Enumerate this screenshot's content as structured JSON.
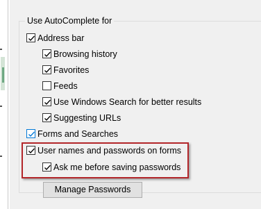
{
  "group": {
    "title": "Use AutoComplete for"
  },
  "options": [
    {
      "label": "Address bar",
      "checked": true
    },
    {
      "label": "Browsing history",
      "checked": true
    },
    {
      "label": "Favorites",
      "checked": true
    },
    {
      "label": "Feeds",
      "checked": false
    },
    {
      "label": "Use Windows Search for better results",
      "checked": true
    },
    {
      "label": "Suggesting URLs",
      "checked": true
    },
    {
      "label": "Forms and Searches",
      "checked": true
    },
    {
      "label": "User names and passwords on forms",
      "checked": true
    },
    {
      "label": "Ask me before saving passwords",
      "checked": true
    }
  ],
  "buttons": {
    "manage_passwords": "Manage Passwords"
  },
  "colors": {
    "highlight_border": "#b3262a",
    "hover_checkbox_border": "#0078d7",
    "dialog_background": "#f0f0f0"
  }
}
